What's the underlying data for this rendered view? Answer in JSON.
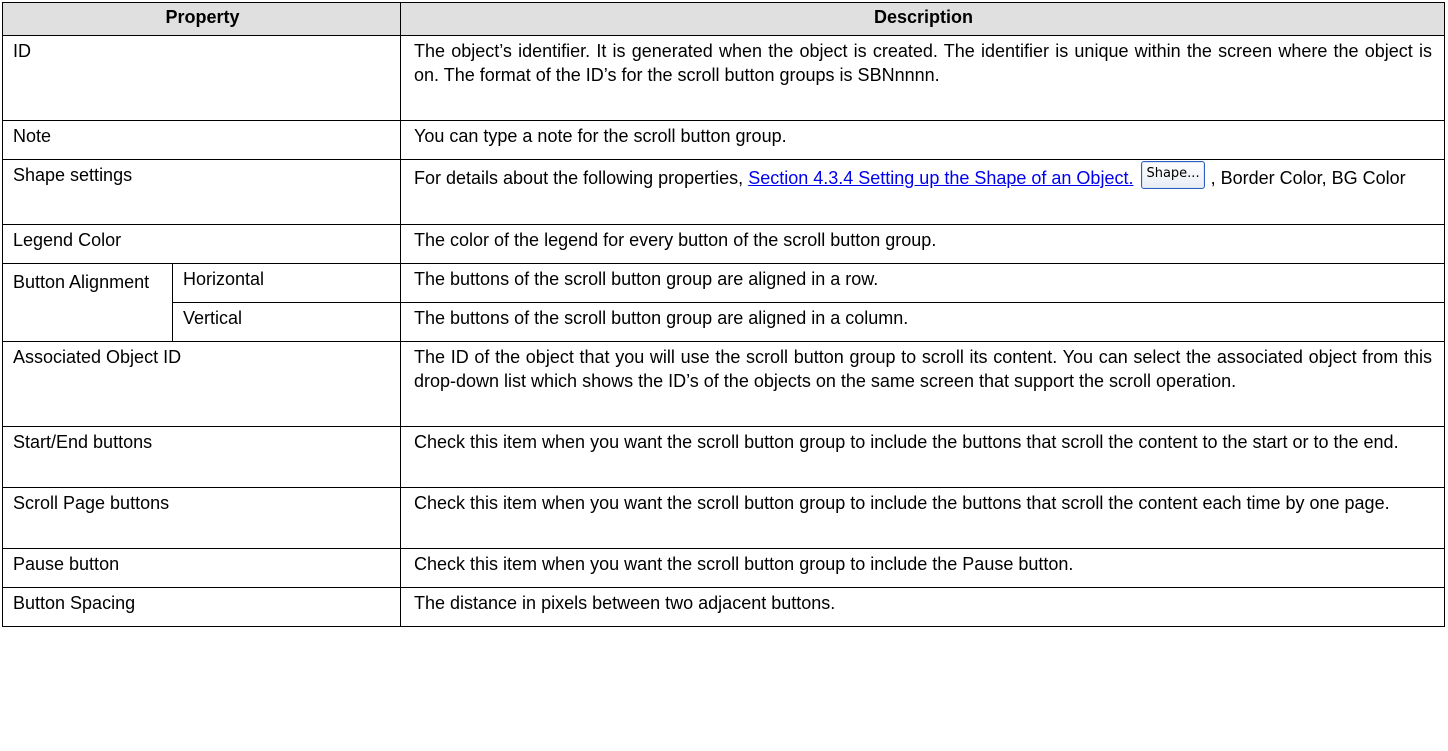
{
  "headers": {
    "property": "Property",
    "description": "Description"
  },
  "rows": {
    "id": {
      "name": "ID",
      "desc": "The object’s identifier. It is generated when the object is created. The identifier is unique within the screen where the object is on. The format of the ID’s for the scroll button groups is SBNnnnn."
    },
    "note": {
      "name": "Note",
      "desc": "You can type a note for the scroll button group."
    },
    "shape": {
      "name": "Shape settings",
      "desc_prefix": "For details about the following properties, ",
      "link_text": "Section 4.3.4 Setting up the Shape of an Object.",
      "button_label": "Shape...",
      "desc_suffix": ", Border Color, BG Color"
    },
    "legend": {
      "name": "Legend Color",
      "desc": "The color of the legend for every button of the scroll button group."
    },
    "alignment": {
      "name": "Button Alignment",
      "horizontal": {
        "name": "Horizontal",
        "desc": "The buttons of the scroll button group are aligned in a row."
      },
      "vertical": {
        "name": "Vertical",
        "desc": "The buttons of the scroll button group are aligned in a column."
      }
    },
    "assoc": {
      "name": "Associated Object ID",
      "desc": "The ID of the object that you will use the scroll button group to scroll its content. You can select the associated object from this drop-down list which shows the ID’s of the objects on the same screen that support the scroll operation."
    },
    "startend": {
      "name": "Start/End buttons",
      "desc": "Check this item when you want the scroll button group to include the buttons that scroll the content to the start or to the end."
    },
    "scrollpage": {
      "name": "Scroll Page buttons",
      "desc": "Check this item when you want the scroll button group to include the buttons that scroll the content each time by one page."
    },
    "pause": {
      "name": "Pause button",
      "desc": "Check this item when you want the scroll button group to include the Pause button."
    },
    "spacing": {
      "name": "Button Spacing",
      "desc": "The distance in pixels between two adjacent buttons."
    }
  }
}
